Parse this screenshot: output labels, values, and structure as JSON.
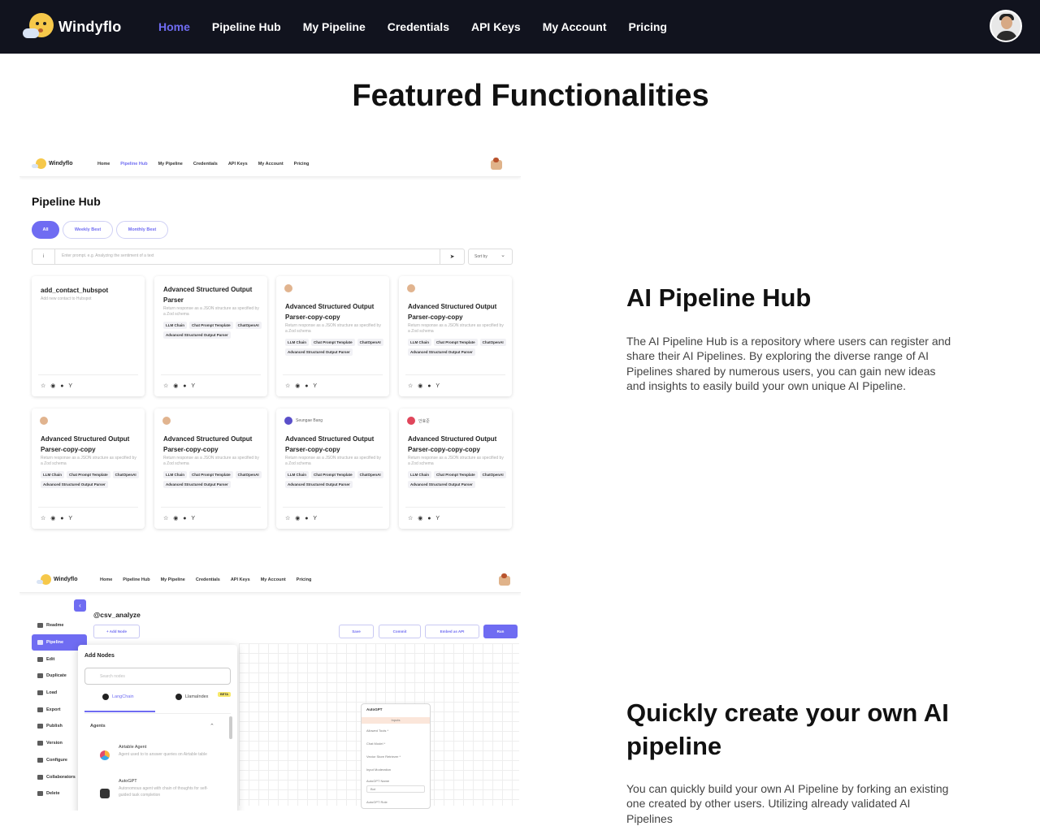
{
  "nav": {
    "brand": "Windyflo",
    "links": [
      "Home",
      "Pipeline Hub",
      "My Pipeline",
      "Credentials",
      "API Keys",
      "My Account",
      "Pricing"
    ],
    "active": "Home"
  },
  "section_title": "Featured Functionalities",
  "features": [
    {
      "title": "AI Pipeline Hub",
      "description": "The AI Pipeline Hub is a repository where users can register and share their AI Pipelines. By exploring the diverse range of AI Pipelines shared by numerous users, you can gain new ideas and insights to easily build your own unique AI Pipeline."
    },
    {
      "title": "Quickly create your own AI pipeline",
      "description": "You can quickly build your own AI Pipeline by forking an existing one created by other users. Utilizing already validated AI Pipelines"
    }
  ],
  "shot1": {
    "brand": "Windyflo",
    "links": [
      "Home",
      "Pipeline Hub",
      "My Pipeline",
      "Credentials",
      "API Keys",
      "My Account",
      "Pricing"
    ],
    "title": "Pipeline Hub",
    "filters": [
      "All",
      "Weekly Best",
      "Monthly Best"
    ],
    "search_icon": "i",
    "search_placeholder": "Enter prompt. e.g. Analyzing the sentiment of a text",
    "send_icon": "➤",
    "sort_label": "Sort by",
    "cards": [
      {
        "author": "",
        "title": "add_contact_hubspot",
        "desc": "Add new contact to Hubspot",
        "tags": [],
        "icons": "☆ ◉ ● Y"
      },
      {
        "author": "",
        "title": "Advanced Structured Output Parser",
        "desc": "Return response as a JSON structure as specified by a Zod schema",
        "tags": [
          "LLM Chain",
          "Chat Prompt Template",
          "ChatOpenAI",
          "Advanced Structured Output Parser"
        ],
        "icons": "☆ ◉ ● Y"
      },
      {
        "author": "",
        "title": "Advanced Structured Output Parser-copy-copy",
        "desc": "Return response as a JSON structure as specified by a Zod schema",
        "tags": [
          "LLM Chain",
          "Chat Prompt Template",
          "ChatOpenAI",
          "Advanced Structured Output Parser"
        ],
        "icons": "☆ ◉ ● Y"
      },
      {
        "author": "",
        "title": "Advanced Structured Output Parser-copy-copy",
        "desc": "Return response as a JSON structure as specified by a Zod schema",
        "tags": [
          "LLM Chain",
          "Chat Prompt Template",
          "ChatOpenAI",
          "Advanced Structured Output Parser"
        ],
        "icons": "☆ ◉ ● Y"
      },
      {
        "author": "",
        "title": "Advanced Structured Output Parser-copy-copy",
        "desc": "Return response as a JSON structure as specified by a Zod schema",
        "tags": [
          "LLM Chain",
          "Chat Prompt Template",
          "ChatOpenAI",
          "Advanced Structured Output Parser"
        ],
        "icons": "☆ ◉ ● Y"
      },
      {
        "author": "",
        "title": "Advanced Structured Output Parser-copy-copy",
        "desc": "Return response as a JSON structure as specified by a Zod schema",
        "tags": [
          "LLM Chain",
          "Chat Prompt Template",
          "ChatOpenAI",
          "Advanced Structured Output Parser"
        ],
        "icons": "☆ ◉ ● Y"
      },
      {
        "author": "Seungae Bang",
        "title": "Advanced Structured Output Parser-copy-copy",
        "desc": "Return response as a JSON structure as specified by a Zod schema",
        "tags": [
          "LLM Chain",
          "Chat Prompt Template",
          "ChatOpenAI",
          "Advanced Structured Output Parser"
        ],
        "icons": "☆ ◉ ● Y"
      },
      {
        "author": "안효준",
        "title": "Advanced Structured Output Parser-copy-copy-copy",
        "desc": "Return response as a JSON structure as specified by a Zod schema",
        "tags": [
          "LLM Chain",
          "Chat Prompt Template",
          "ChatOpenAI",
          "Advanced Structured Output Parser"
        ],
        "icons": "☆ ◉ ● Y"
      }
    ]
  },
  "shot2": {
    "brand": "Windyflo",
    "links": [
      "Home",
      "Pipeline Hub",
      "My Pipeline",
      "Credentials",
      "API Keys",
      "My Account",
      "Pricing"
    ],
    "collapse_icon": "‹",
    "sidebar": [
      "Readme",
      "Pipeline",
      "Edit",
      "Duplicate",
      "Load",
      "Export",
      "Publish",
      "Version",
      "Configure",
      "Collaborators",
      "Delete"
    ],
    "pipeline_name": "@csv_analyze",
    "add_node_label": "+ Add Node",
    "buttons": [
      "Save",
      "Commit",
      "Embed as API",
      "Run"
    ],
    "panel": {
      "title": "Add Nodes",
      "search_placeholder": "Search nodes",
      "tabs": [
        "LangChain",
        "LlamaIndex"
      ],
      "beta": "BETA",
      "group": "Agents",
      "chevron": "⌃",
      "agents": [
        {
          "name": "Airtable Agent",
          "desc": "Agent used to to answer queries on Airtable table"
        },
        {
          "name": "AutoGPT",
          "desc": "Autonomous agent with chain of thoughts for self-guided task completion"
        }
      ]
    },
    "node": {
      "title": "AutoGPT",
      "band": "Inputs",
      "fields": [
        "Allowed Tools *",
        "Chat Model *",
        "Vector Store Retriever *",
        "Input Moderation",
        "AutoGPT Name",
        "AutoGPT Role"
      ],
      "name_placeholder": "Bot"
    }
  }
}
